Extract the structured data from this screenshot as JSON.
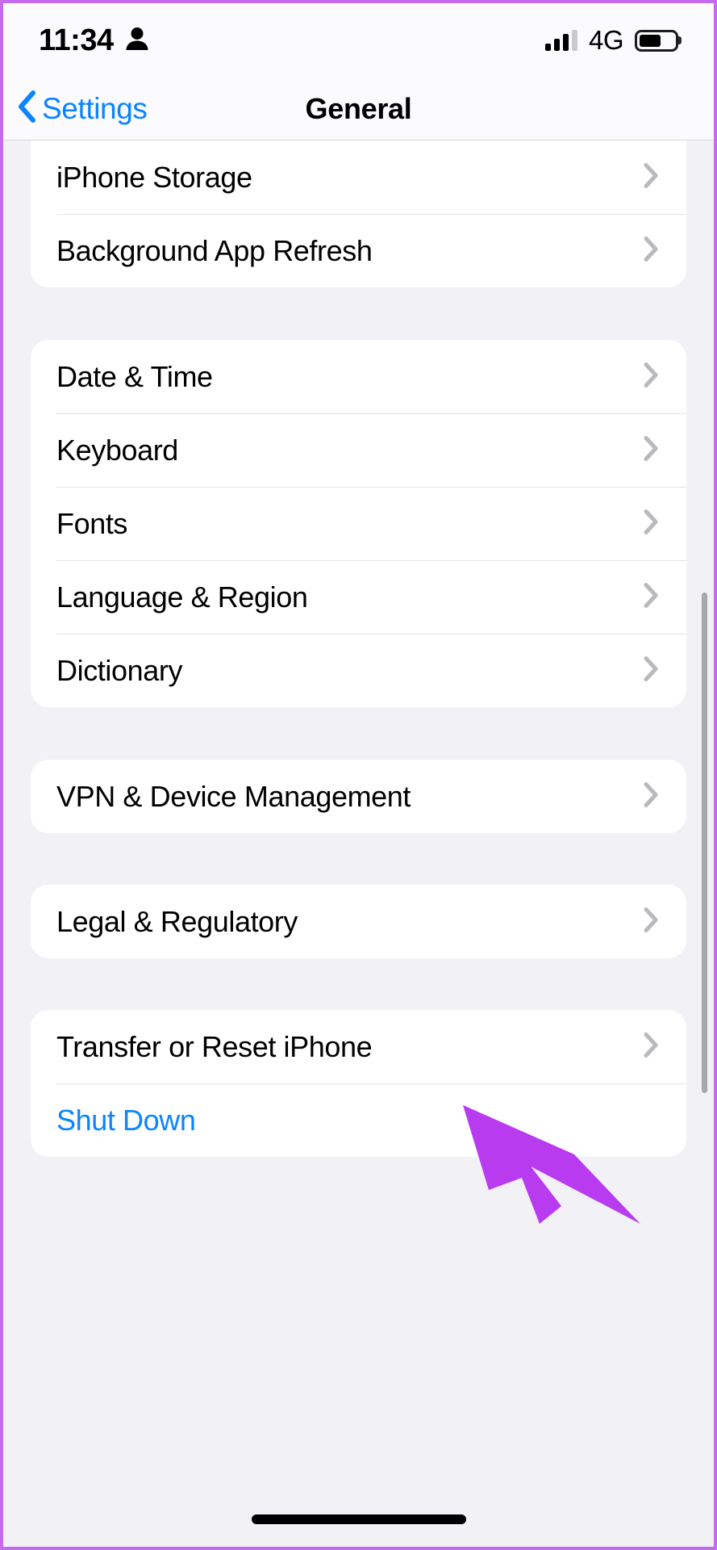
{
  "status_bar": {
    "time": "11:34",
    "person_icon": "person-icon",
    "signal_icon": "cellular-bars-icon",
    "signal_bars_filled": 3,
    "signal_bars_total": 4,
    "network": "4G",
    "battery_icon": "battery-icon",
    "battery_level_percent": 62
  },
  "nav_bar": {
    "back_icon": "chevron-left-icon",
    "back_label": "Settings",
    "title": "General"
  },
  "groups": [
    {
      "id": "group-storage",
      "rows": [
        {
          "label": "iPhone Storage",
          "accessory": "chevron-right-icon",
          "style": "default"
        },
        {
          "label": "Background App Refresh",
          "accessory": "chevron-right-icon",
          "style": "default"
        }
      ]
    },
    {
      "id": "group-locale",
      "rows": [
        {
          "label": "Date & Time",
          "accessory": "chevron-right-icon",
          "style": "default"
        },
        {
          "label": "Keyboard",
          "accessory": "chevron-right-icon",
          "style": "default"
        },
        {
          "label": "Fonts",
          "accessory": "chevron-right-icon",
          "style": "default"
        },
        {
          "label": "Language & Region",
          "accessory": "chevron-right-icon",
          "style": "default"
        },
        {
          "label": "Dictionary",
          "accessory": "chevron-right-icon",
          "style": "default"
        }
      ]
    },
    {
      "id": "group-vpn",
      "rows": [
        {
          "label": "VPN & Device Management",
          "accessory": "chevron-right-icon",
          "style": "default"
        }
      ]
    },
    {
      "id": "group-legal",
      "rows": [
        {
          "label": "Legal & Regulatory",
          "accessory": "chevron-right-icon",
          "style": "default"
        }
      ]
    },
    {
      "id": "group-reset",
      "rows": [
        {
          "label": "Transfer or Reset iPhone",
          "accessory": "chevron-right-icon",
          "style": "default"
        },
        {
          "label": "Shut Down",
          "accessory": "none",
          "style": "link"
        }
      ]
    }
  ],
  "annotation": {
    "arrow_icon": "purple-arrow-pointer-icon",
    "color": "#b83bf0",
    "points_at": "VPN & Device Management"
  },
  "colors": {
    "accent_blue": "#0a84ff",
    "page_background": "#f2f1f6",
    "card_background": "#ffffff",
    "separator": "#e4e4e8",
    "chevron_gray": "#b9b9be",
    "annotation_purple": "#b83bf0",
    "frame_purple": "#c46bf0"
  },
  "home_indicator": "home-indicator"
}
